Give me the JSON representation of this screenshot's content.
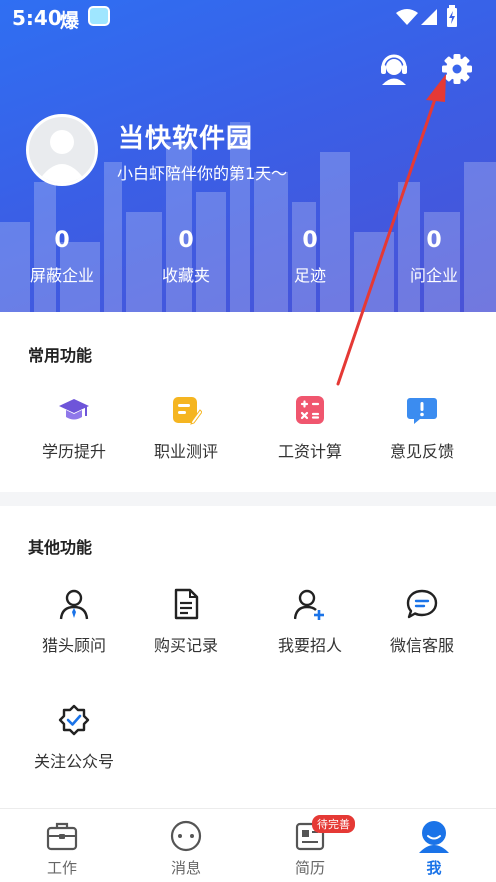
{
  "status_bar": {
    "time": "5:40",
    "app_glyph": "爆"
  },
  "profile": {
    "name": "当快软件园",
    "subtitle": "小白虾陪伴你的第1天～"
  },
  "stats": [
    {
      "value": "0",
      "label": "屏蔽企业"
    },
    {
      "value": "0",
      "label": "收藏夹"
    },
    {
      "value": "0",
      "label": "足迹"
    },
    {
      "value": "0",
      "label": "问企业"
    }
  ],
  "common_functions": {
    "title": "常用功能",
    "items": [
      {
        "label": "学历提升",
        "icon": "graduation-cap-icon"
      },
      {
        "label": "职业测评",
        "icon": "assessment-icon"
      },
      {
        "label": "工资计算",
        "icon": "calculator-icon"
      },
      {
        "label": "意见反馈",
        "icon": "feedback-icon"
      }
    ]
  },
  "other_functions": {
    "title": "其他功能",
    "items": [
      {
        "label": "猎头顾问",
        "icon": "headhunter-icon"
      },
      {
        "label": "购买记录",
        "icon": "purchase-record-icon"
      },
      {
        "label": "我要招人",
        "icon": "add-person-icon"
      },
      {
        "label": "微信客服",
        "icon": "chat-bubble-icon"
      },
      {
        "label": "关注公众号",
        "icon": "verified-badge-icon"
      }
    ]
  },
  "tabbar": {
    "items": [
      {
        "label": "工作",
        "icon": "briefcase-icon"
      },
      {
        "label": "消息",
        "icon": "message-icon"
      },
      {
        "label": "简历",
        "icon": "resume-icon",
        "badge": "待完善"
      },
      {
        "label": "我",
        "icon": "person-icon",
        "active": true
      }
    ]
  },
  "colors": {
    "header_start": "#2f6ff2",
    "header_end": "#4a52d6",
    "accent": "#1a73e8",
    "badge": "#e53935",
    "arrow": "#e53935"
  }
}
